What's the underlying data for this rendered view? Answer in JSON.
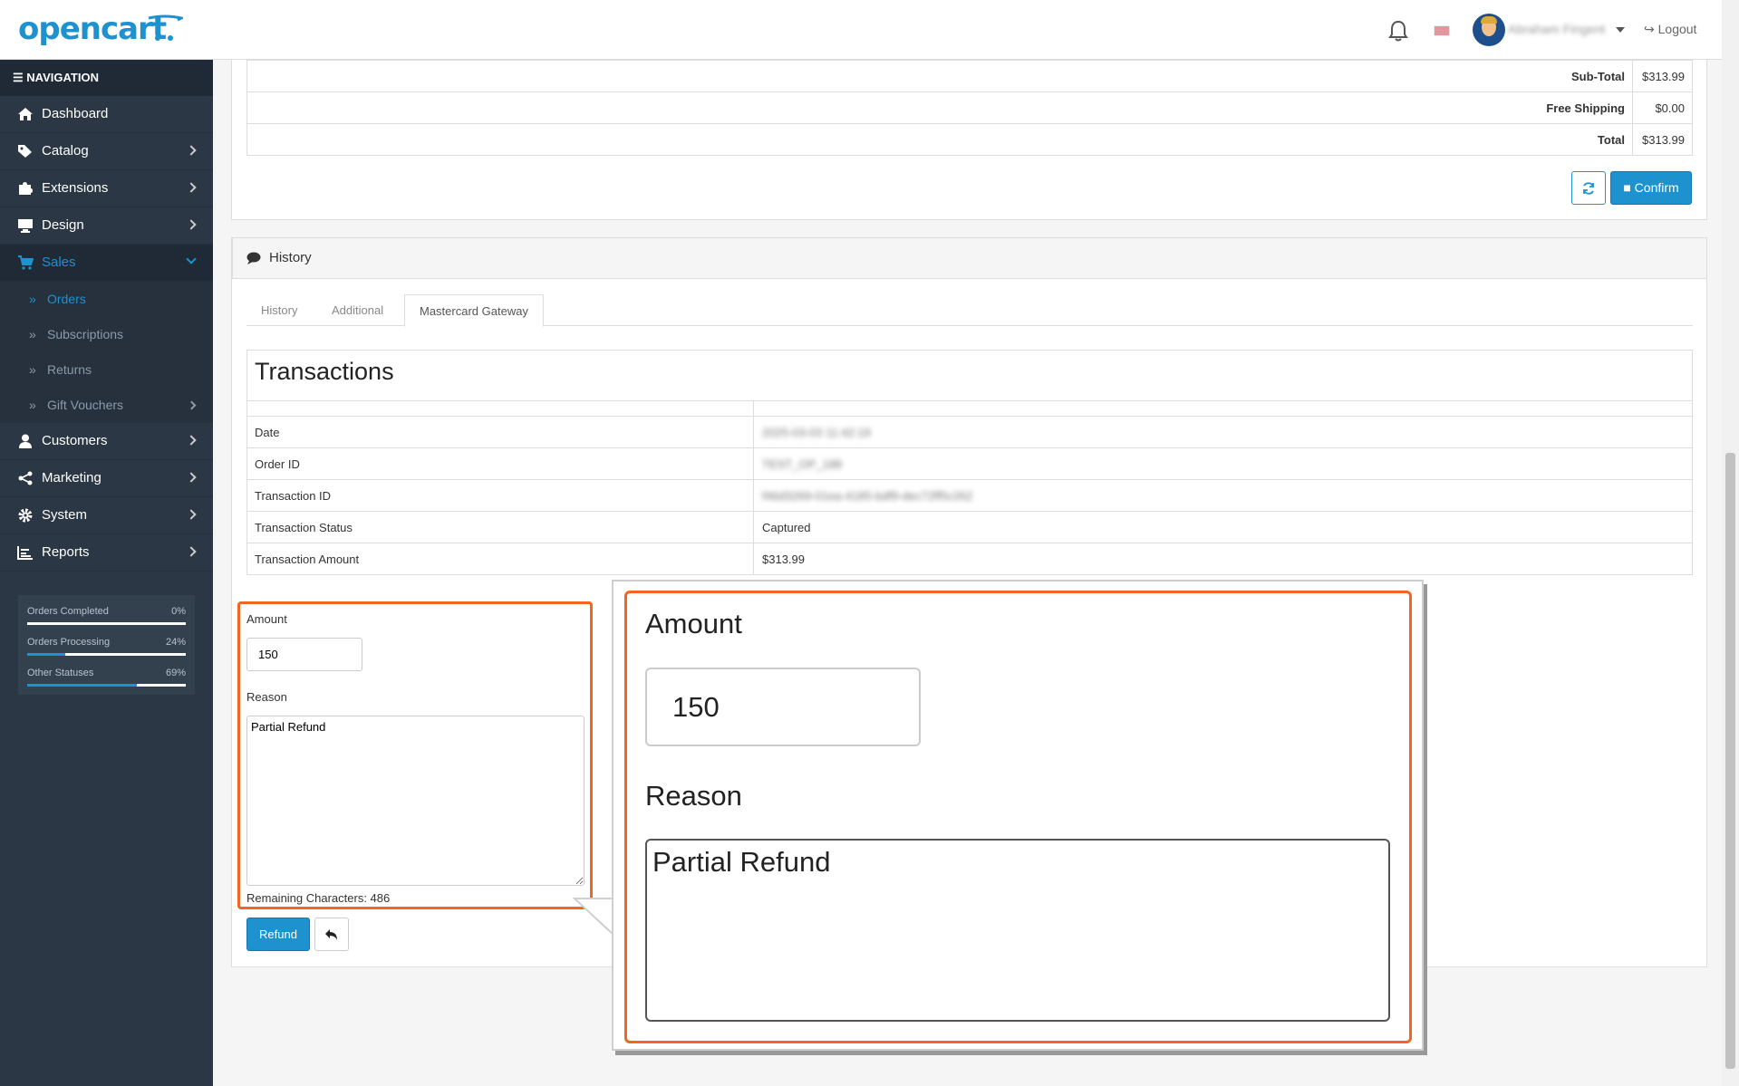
{
  "header": {
    "logo": "opencart",
    "user_name": "Abraham Fingent",
    "logout_label": "Logout"
  },
  "sidebar": {
    "heading": "NAVIGATION",
    "items": [
      {
        "label": "Dashboard"
      },
      {
        "label": "Catalog"
      },
      {
        "label": "Extensions"
      },
      {
        "label": "Design"
      },
      {
        "label": "Sales"
      }
    ],
    "sales_sub": [
      {
        "label": "Orders"
      },
      {
        "label": "Subscriptions"
      },
      {
        "label": "Returns"
      },
      {
        "label": "Gift Vouchers"
      }
    ],
    "items_after": [
      {
        "label": "Customers"
      },
      {
        "label": "Marketing"
      },
      {
        "label": "System"
      },
      {
        "label": "Reports"
      }
    ],
    "stats": [
      {
        "label": "Orders Completed",
        "percent": "0%",
        "value": 0
      },
      {
        "label": "Orders Processing",
        "percent": "24%",
        "value": 24
      },
      {
        "label": "Other Statuses",
        "percent": "69%",
        "value": 69
      }
    ]
  },
  "totals": [
    {
      "label": "Sub-Total",
      "value": "$313.99"
    },
    {
      "label": "Free Shipping",
      "value": "$0.00"
    },
    {
      "label": "Total",
      "value": "$313.99"
    }
  ],
  "confirm_label": "Confirm",
  "history": {
    "heading": "History",
    "tabs": [
      {
        "label": "History"
      },
      {
        "label": "Additional"
      },
      {
        "label": "Mastercard Gateway"
      }
    ]
  },
  "transactions": {
    "title": "Transactions",
    "rows": [
      {
        "key": "Date",
        "value": "2025-03-03 11:42:19"
      },
      {
        "key": "Order ID",
        "value": "TEST_OP_188"
      },
      {
        "key": "Transaction ID",
        "value": "f46d3269-01ea-4185-bdf9-dec72ff5c262"
      },
      {
        "key": "Transaction Status",
        "value": "Captured"
      },
      {
        "key": "Transaction Amount",
        "value": "$313.99"
      }
    ]
  },
  "refund_form": {
    "amount_label": "Amount",
    "amount_value": "150",
    "reason_label": "Reason",
    "reason_value": "Partial Refund",
    "remaining": "Remaining Characters: 486",
    "refund_label": "Refund"
  }
}
